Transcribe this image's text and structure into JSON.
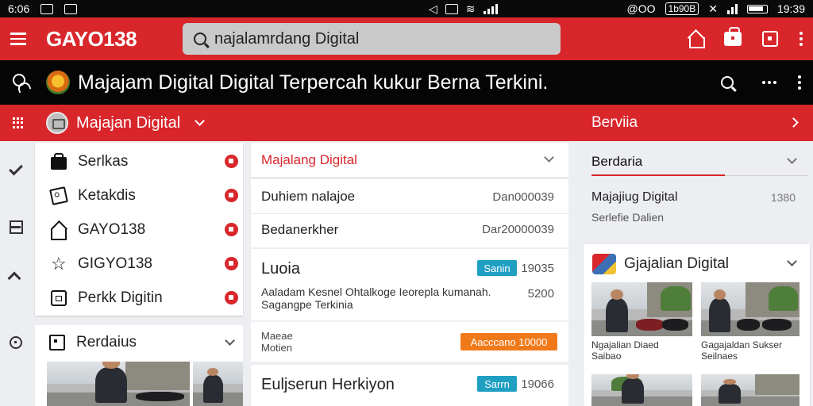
{
  "status": {
    "left_time": "6:06",
    "center_text": "@OO",
    "center_badge": "1b90B",
    "right_time": "19:39"
  },
  "appbar": {
    "brand": "GAYO138",
    "search_text": "najalamrdang Digital"
  },
  "headline": {
    "text": "Majajam Digital Digital Terpercah kukur Berna Terkini."
  },
  "category": {
    "title": "Majajan Digital",
    "right_label": "Berviia"
  },
  "menu": {
    "items": [
      {
        "label": "Serlkas"
      },
      {
        "label": "Ketakdis"
      },
      {
        "label": "GAYO138"
      },
      {
        "label": "GIGYO138"
      },
      {
        "label": "Perkk Digitin"
      }
    ]
  },
  "featured": {
    "title": "Rerdaius"
  },
  "list": {
    "header": "Majalang Digital",
    "kv": [
      {
        "key": "Duhiem nalajoe",
        "value": "Dan000039"
      },
      {
        "key": "Bedanerkher",
        "value": "Dar20000039"
      }
    ],
    "articles": [
      {
        "title": "Luoia",
        "tag": "Sanin",
        "tag_color": "#1f9fc2",
        "num": "19035",
        "desc": "Aaladam Kesnel Ohtalkoge Ieorepla kumanah. Sagangpe Terkinia",
        "num2": "5200"
      },
      {
        "sub": "Maeae Motien",
        "tag": "Aacccano 10000",
        "tag_color": "#f07a1a"
      },
      {
        "title": "Euljserun Herkiyon",
        "tag": "Sarrn",
        "tag_color": "#1f9fc2",
        "num": "19066"
      }
    ]
  },
  "side": {
    "tab": "Berdaria",
    "item_title": "Majajiug Digital",
    "item_sub": "Serlefie Dalien",
    "item_num": "1380",
    "card_title": "Gjajalian Digital",
    "thumbs": [
      {
        "caption": "Ngajalian Diaed Saibao"
      },
      {
        "caption": "Gagajaldan Sukser Seilnaes"
      }
    ]
  },
  "colors": {
    "brand_red": "#d8262b",
    "tag_blue": "#1f9fc2",
    "tag_orange": "#f07a1a"
  }
}
